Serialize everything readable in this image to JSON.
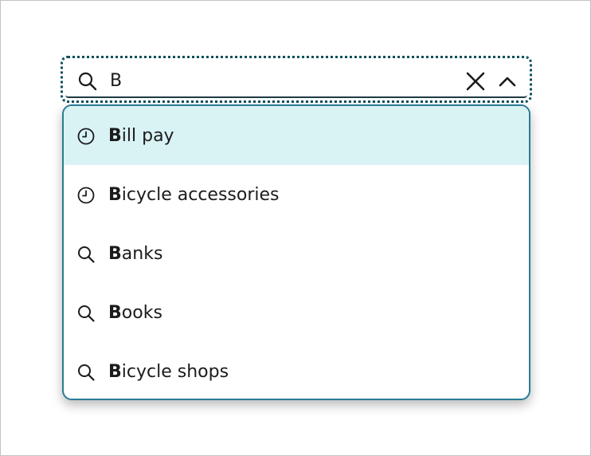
{
  "search": {
    "value": "B",
    "icon": "search-icon"
  },
  "controls": {
    "clear_icon": "close-icon",
    "collapse_icon": "chevron-up-icon"
  },
  "suggestions": [
    {
      "match": "B",
      "rest": "ill pay",
      "icon": "clock-icon",
      "type": "recent"
    },
    {
      "match": "B",
      "rest": "icycle accessories",
      "icon": "clock-icon",
      "type": "recent"
    },
    {
      "match": "B",
      "rest": "anks",
      "icon": "search-icon",
      "type": "search"
    },
    {
      "match": "B",
      "rest": "ooks",
      "icon": "search-icon",
      "type": "search"
    },
    {
      "match": "B",
      "rest": "icycle shops",
      "icon": "search-icon",
      "type": "search"
    }
  ],
  "colors": {
    "focus_ring": "#0d4f5c",
    "dropdown_border": "#2a7b95",
    "active_option_bg": "#d9f3f5",
    "text": "#1b1b1b"
  }
}
